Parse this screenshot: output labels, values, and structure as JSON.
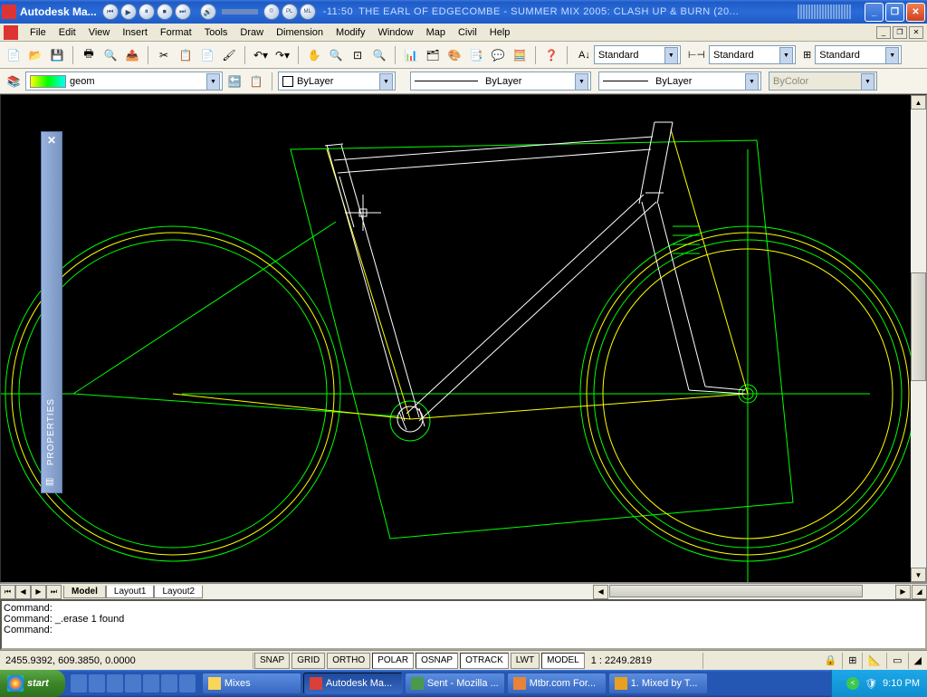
{
  "titlebar": {
    "app_title": "Autodesk Ma...",
    "media_time": "-11:50",
    "media_text": "THE EARL OF EDGECOMBE - SUMMER MIX 2005: CLASH UP & BURN (20..."
  },
  "menu": [
    "File",
    "Edit",
    "View",
    "Insert",
    "Format",
    "Tools",
    "Draw",
    "Dimension",
    "Modify",
    "Window",
    "Map",
    "Civil",
    "Help"
  ],
  "style_dropdowns": {
    "text_style": "Standard",
    "dim_style": "Standard",
    "table_style": "Standard"
  },
  "layer_row": {
    "current_layer": "geom",
    "color": "ByLayer",
    "linetype": "ByLayer",
    "lineweight": "ByLayer",
    "plotstyle": "ByColor"
  },
  "properties_label": "PROPERTIES",
  "tabs": [
    "Model",
    "Layout1",
    "Layout2"
  ],
  "command": {
    "line1": "Command:",
    "line2": "Command: _.erase 1 found",
    "line3": "Command:"
  },
  "status": {
    "coords": "2455.9392, 609.3850, 0.0000",
    "toggles": [
      "SNAP",
      "GRID",
      "ORTHO",
      "POLAR",
      "OSNAP",
      "OTRACK",
      "LWT",
      "MODEL"
    ],
    "active_toggles": [
      "POLAR",
      "OSNAP",
      "OTRACK",
      "MODEL"
    ],
    "scale": "1 : 2249.2819"
  },
  "taskbar": {
    "start": "start",
    "tasks": [
      {
        "label": "Mixes",
        "icon": "#fbd45a"
      },
      {
        "label": "Autodesk Ma...",
        "icon": "#d8403a",
        "active": true
      },
      {
        "label": "Sent - Mozilla ...",
        "icon": "#4a9a4a"
      },
      {
        "label": "Mtbr.com For...",
        "icon": "#e8843a"
      },
      {
        "label": "1. Mixed by T...",
        "icon": "#e8a020"
      }
    ],
    "time": "9:10 PM"
  }
}
